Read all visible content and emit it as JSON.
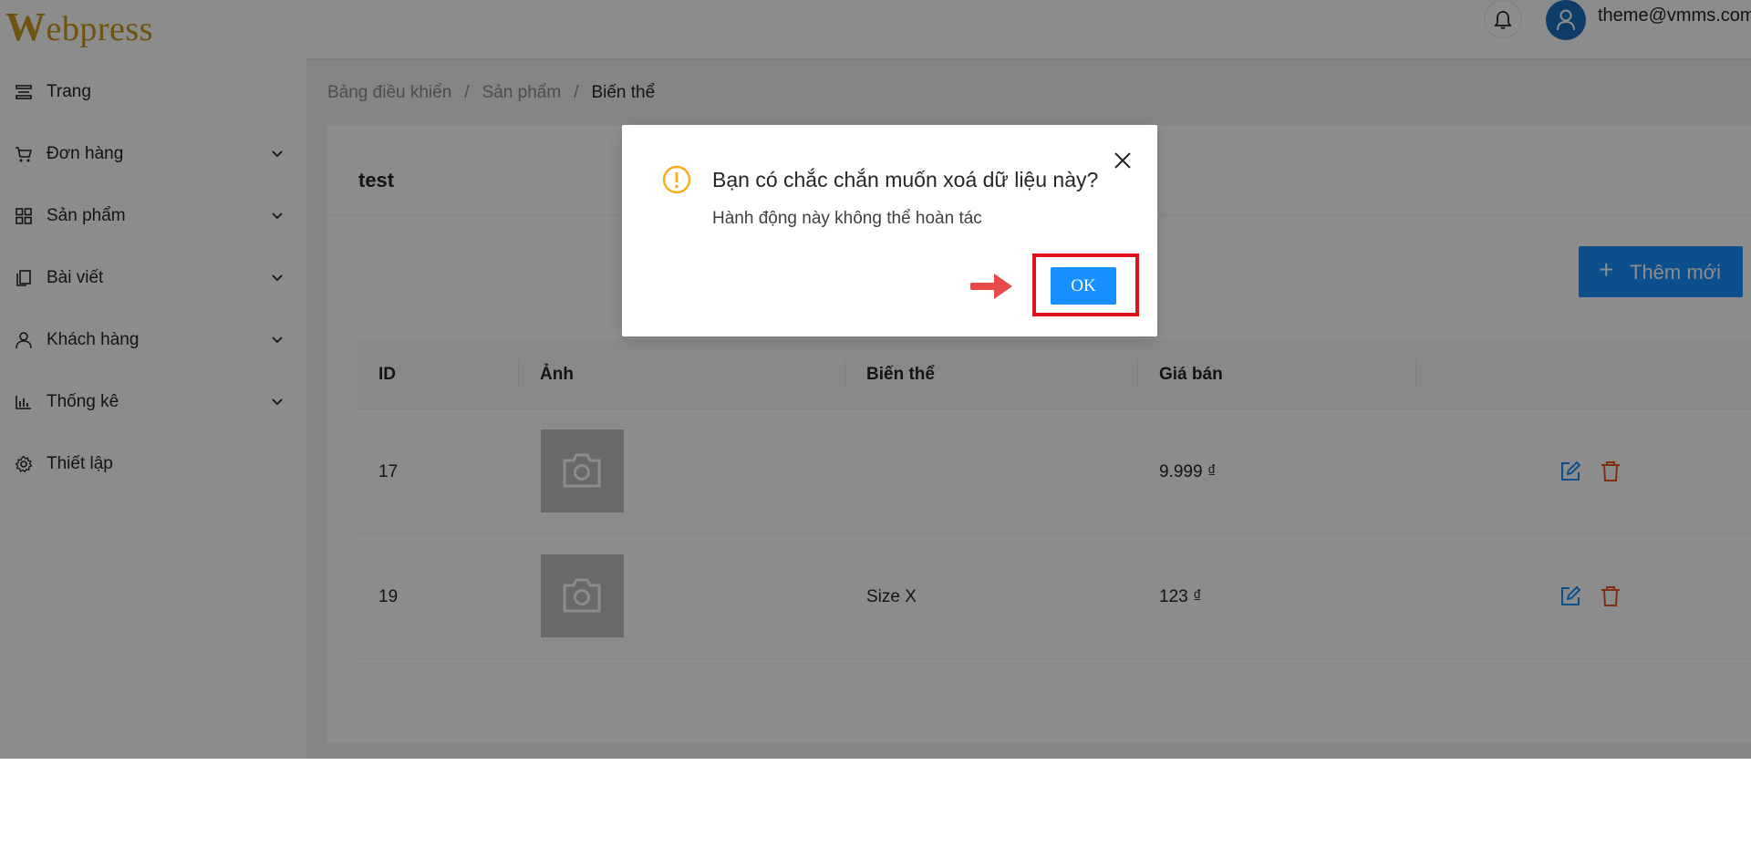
{
  "header": {
    "logo_initial": "W",
    "logo_rest": "ebpress",
    "user_email": "theme@vmms.com"
  },
  "sidebar": {
    "items": [
      {
        "label": "Trang",
        "icon": "page-icon",
        "has_submenu": false
      },
      {
        "label": "Đơn hàng",
        "icon": "cart-icon",
        "has_submenu": true
      },
      {
        "label": "Sản phẩm",
        "icon": "grid-icon",
        "has_submenu": true
      },
      {
        "label": "Bài viết",
        "icon": "copy-icon",
        "has_submenu": true
      },
      {
        "label": "Khách hàng",
        "icon": "user-icon",
        "has_submenu": true
      },
      {
        "label": "Thống kê",
        "icon": "bar-chart-icon",
        "has_submenu": true
      },
      {
        "label": "Thiết lập",
        "icon": "gear-icon",
        "has_submenu": false
      }
    ]
  },
  "breadcrumb": {
    "items": [
      "Bảng điều khiển",
      "Sản phẩm"
    ],
    "current": "Biến thể",
    "separator": "/"
  },
  "card": {
    "title": "test",
    "add_button_label": "Thêm mới"
  },
  "table": {
    "columns": [
      "ID",
      "Ảnh",
      "Biến thể",
      "Giá bán"
    ],
    "rows": [
      {
        "id": "17",
        "variant": "",
        "price": "9.999 ₫"
      },
      {
        "id": "19",
        "variant": "Size X",
        "price": "123 ₫"
      }
    ]
  },
  "modal": {
    "title": "Bạn có chắc chắn muốn xoá dữ liệu này?",
    "content": "Hành động này không thể hoàn tác",
    "ok_label": "OK"
  },
  "colors": {
    "primary": "#1890ff",
    "warning": "#faad14",
    "highlight": "#e0101c",
    "arrow": "#e84a4a",
    "edit": "#1890ff",
    "delete": "#e8541c",
    "logo": "#c99a1e"
  }
}
